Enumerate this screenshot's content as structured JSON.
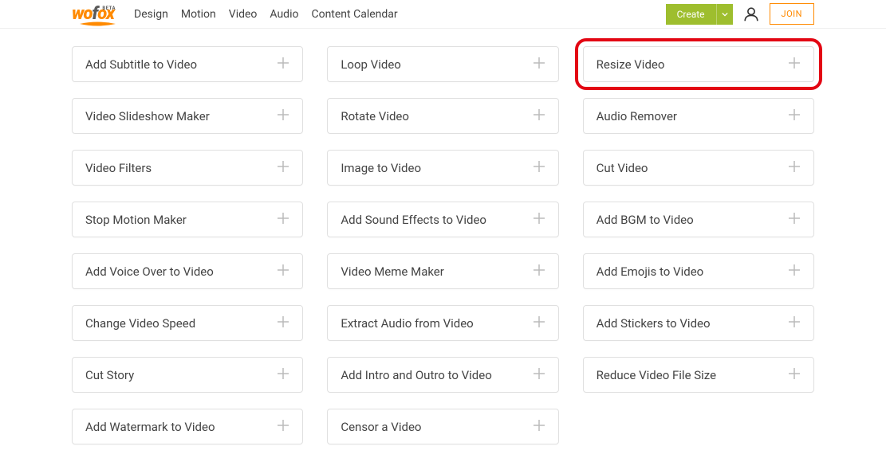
{
  "header": {
    "logo": {
      "w": "w",
      "o": "o",
      "f": "f",
      "ox": "ox",
      "beta": "BETA"
    },
    "nav": [
      {
        "label": "Design"
      },
      {
        "label": "Motion"
      },
      {
        "label": "Video"
      },
      {
        "label": "Audio"
      },
      {
        "label": "Content Calendar"
      }
    ],
    "create_label": "Create",
    "join_label": "JOIN"
  },
  "cards": [
    {
      "label": "Add Subtitle to Video",
      "highlighted": false
    },
    {
      "label": "Loop Video",
      "highlighted": false
    },
    {
      "label": "Resize Video",
      "highlighted": true
    },
    {
      "label": "Video Slideshow Maker",
      "highlighted": false
    },
    {
      "label": "Rotate Video",
      "highlighted": false
    },
    {
      "label": "Audio Remover",
      "highlighted": false
    },
    {
      "label": "Video Filters",
      "highlighted": false
    },
    {
      "label": "Image to Video",
      "highlighted": false
    },
    {
      "label": "Cut Video",
      "highlighted": false
    },
    {
      "label": "Stop Motion Maker",
      "highlighted": false
    },
    {
      "label": "Add Sound Effects to Video",
      "highlighted": false
    },
    {
      "label": "Add BGM to Video",
      "highlighted": false
    },
    {
      "label": "Add Voice Over to Video",
      "highlighted": false
    },
    {
      "label": "Video Meme Maker",
      "highlighted": false
    },
    {
      "label": "Add Emojis to Video",
      "highlighted": false
    },
    {
      "label": "Change Video Speed",
      "highlighted": false
    },
    {
      "label": "Extract Audio from Video",
      "highlighted": false
    },
    {
      "label": "Add Stickers to Video",
      "highlighted": false
    },
    {
      "label": "Cut Story",
      "highlighted": false
    },
    {
      "label": "Add Intro and Outro to Video",
      "highlighted": false
    },
    {
      "label": "Reduce Video File Size",
      "highlighted": false
    },
    {
      "label": "Add Watermark to Video",
      "highlighted": false
    },
    {
      "label": "Censor a Video",
      "highlighted": false
    }
  ]
}
